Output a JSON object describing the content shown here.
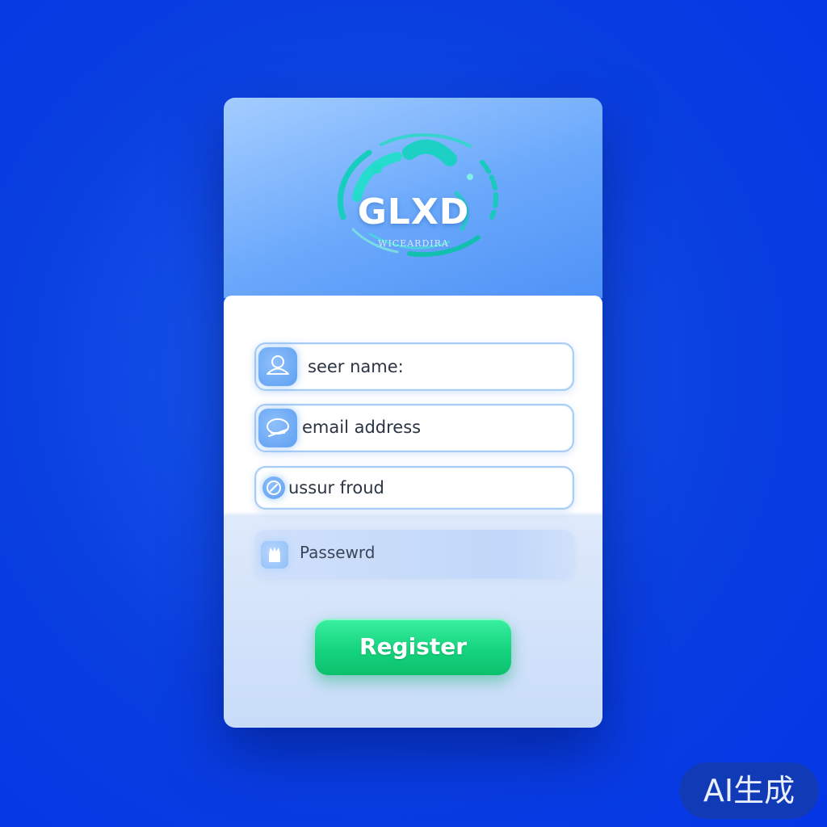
{
  "logo": {
    "text": "GLXD",
    "subtitle": "WICEARDIRA",
    "brand_colors": {
      "ring": "#19d6c4",
      "ring_light": "#8ff3e9"
    }
  },
  "form": {
    "fields": [
      {
        "text": "seer name:",
        "icon": "user-icon"
      },
      {
        "text": "email address",
        "icon": "mail-icon"
      },
      {
        "text": "ussur froud",
        "icon": "edit-icon"
      },
      {
        "text": "Passewrd",
        "icon": "lock-icon"
      }
    ],
    "register_label": "Register"
  },
  "colors": {
    "background": "#0a3fe0",
    "header": "#6aa8fb",
    "field_border": "#a7ccf5",
    "button": "#16d47e"
  },
  "watermark": {
    "text": "AI生成"
  }
}
